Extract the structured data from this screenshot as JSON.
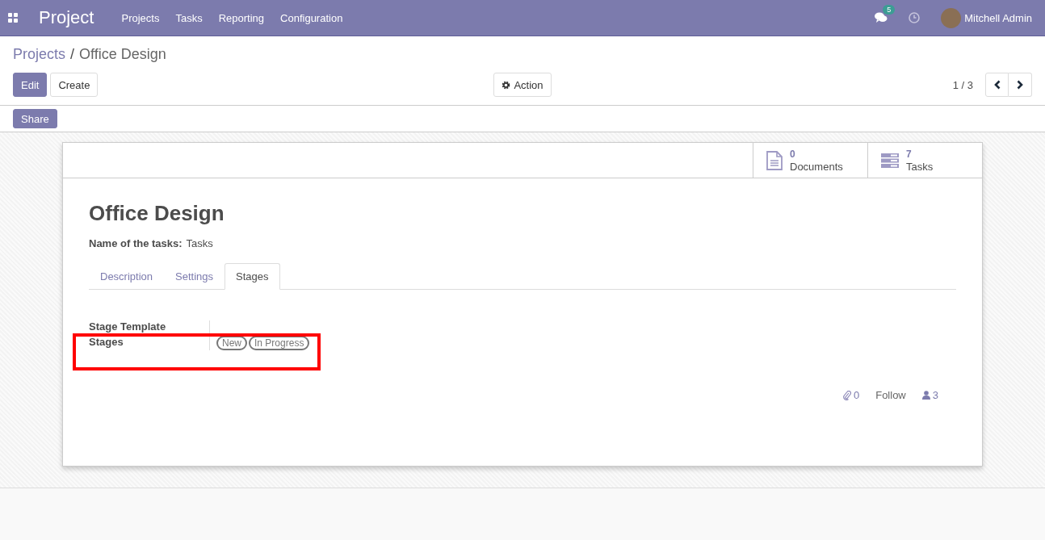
{
  "navbar": {
    "app_name": "Project",
    "menu": [
      "Projects",
      "Tasks",
      "Reporting",
      "Configuration"
    ],
    "messages_count": "5",
    "user": "Mitchell Admin"
  },
  "breadcrumb": {
    "parent": "Projects",
    "separator": "/",
    "current": "Office Design"
  },
  "buttons": {
    "edit": "Edit",
    "create": "Create",
    "action": "Action",
    "share": "Share"
  },
  "pager": {
    "value": "1 / 3"
  },
  "smart_buttons": [
    {
      "kind": "documents",
      "count": "0",
      "label": "Documents"
    },
    {
      "kind": "tasks",
      "count": "7",
      "label": "Tasks"
    }
  ],
  "record": {
    "title": "Office Design",
    "fields": [
      {
        "label": "Name of the tasks:",
        "value": "Tasks"
      }
    ]
  },
  "tabs": [
    {
      "label": "Description",
      "selected": false
    },
    {
      "label": "Settings",
      "selected": false
    },
    {
      "label": "Stages",
      "selected": true
    }
  ],
  "stage_fields": [
    {
      "label": "Stage Template"
    },
    {
      "label": "Stages",
      "tags": [
        "New",
        "In Progress"
      ]
    }
  ],
  "chatter": {
    "attachments": "0",
    "follow": "Follow",
    "followers": "3"
  }
}
